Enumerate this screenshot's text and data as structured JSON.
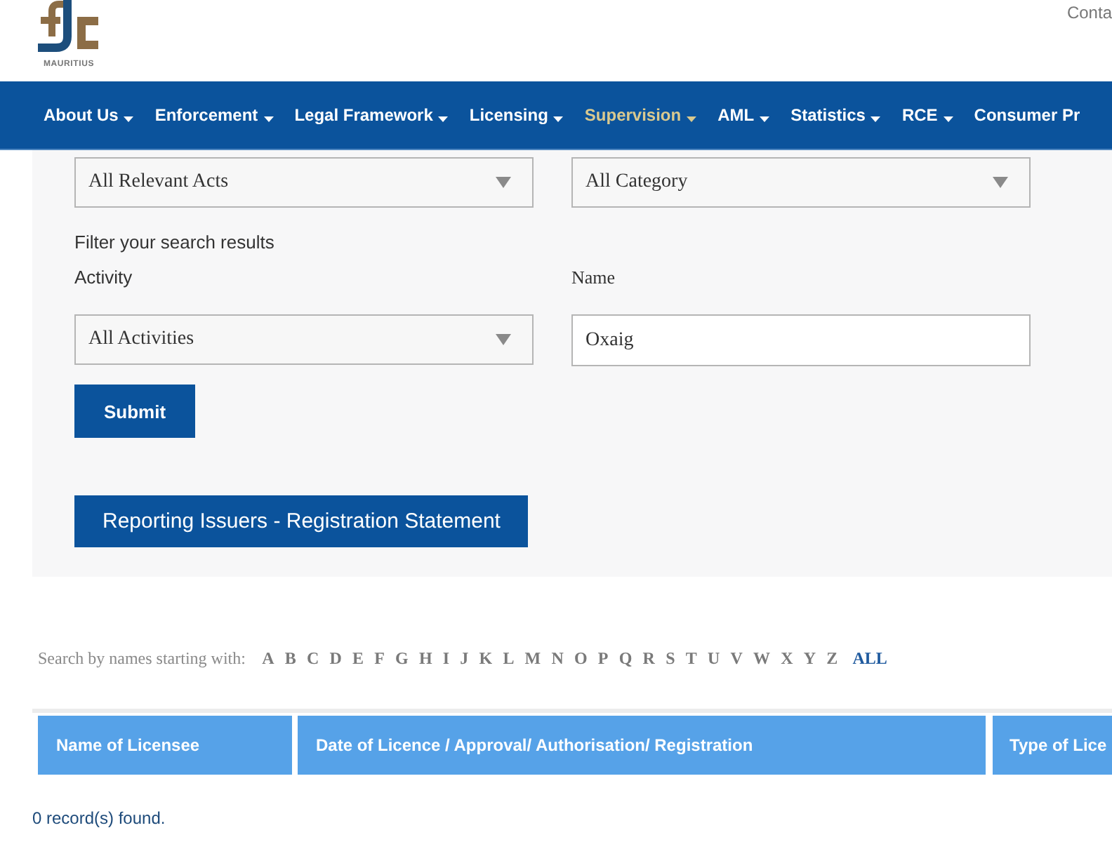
{
  "header": {
    "logo_caption": "MAURITIUS",
    "top_link": "Conta"
  },
  "nav": [
    {
      "label": "About Us",
      "selected": false,
      "dropdown": true
    },
    {
      "label": "Enforcement",
      "selected": false,
      "dropdown": true
    },
    {
      "label": "Legal Framework",
      "selected": false,
      "dropdown": true
    },
    {
      "label": "Licensing",
      "selected": false,
      "dropdown": true
    },
    {
      "label": "Supervision",
      "selected": true,
      "dropdown": true
    },
    {
      "label": "AML",
      "selected": false,
      "dropdown": true
    },
    {
      "label": "Statistics",
      "selected": false,
      "dropdown": true
    },
    {
      "label": "RCE",
      "selected": false,
      "dropdown": true
    },
    {
      "label": "Consumer Pr",
      "selected": false,
      "dropdown": false
    }
  ],
  "filters": {
    "top_selects": [
      {
        "value": "All Relevant Acts"
      },
      {
        "value": "All Category"
      }
    ],
    "heading": "Filter your search results",
    "activity": {
      "label": "Activity",
      "value": "All Activities"
    },
    "name": {
      "label": "Name",
      "value": "Oxaig"
    },
    "submit": "Submit",
    "report_button": "Reporting Issuers - Registration Statement"
  },
  "alphabet": {
    "label": "Search by names starting with:",
    "letters": [
      {
        "text": "A",
        "selected": false
      },
      {
        "text": "B",
        "selected": false
      },
      {
        "text": "C",
        "selected": false
      },
      {
        "text": "D",
        "selected": false
      },
      {
        "text": "E",
        "selected": false
      },
      {
        "text": "F",
        "selected": false
      },
      {
        "text": "G",
        "selected": false
      },
      {
        "text": "H",
        "selected": false
      },
      {
        "text": "I",
        "selected": false
      },
      {
        "text": "J",
        "selected": false
      },
      {
        "text": "K",
        "selected": false
      },
      {
        "text": "L",
        "selected": false
      },
      {
        "text": "M",
        "selected": false
      },
      {
        "text": "N",
        "selected": false
      },
      {
        "text": "O",
        "selected": false
      },
      {
        "text": "P",
        "selected": false
      },
      {
        "text": "Q",
        "selected": false
      },
      {
        "text": "R",
        "selected": false
      },
      {
        "text": "S",
        "selected": false
      },
      {
        "text": "T",
        "selected": false
      },
      {
        "text": "U",
        "selected": false
      },
      {
        "text": "V",
        "selected": false
      },
      {
        "text": "W",
        "selected": false
      },
      {
        "text": "X",
        "selected": false
      },
      {
        "text": "Y",
        "selected": false
      },
      {
        "text": "Z",
        "selected": false
      },
      {
        "text": "ALL",
        "selected": true
      }
    ]
  },
  "table": {
    "columns": [
      "Name of Licensee",
      "Date of Licence / Approval/ Authorisation/ Registration",
      "Type of Lice"
    ]
  },
  "status": "0 record(s) found."
}
